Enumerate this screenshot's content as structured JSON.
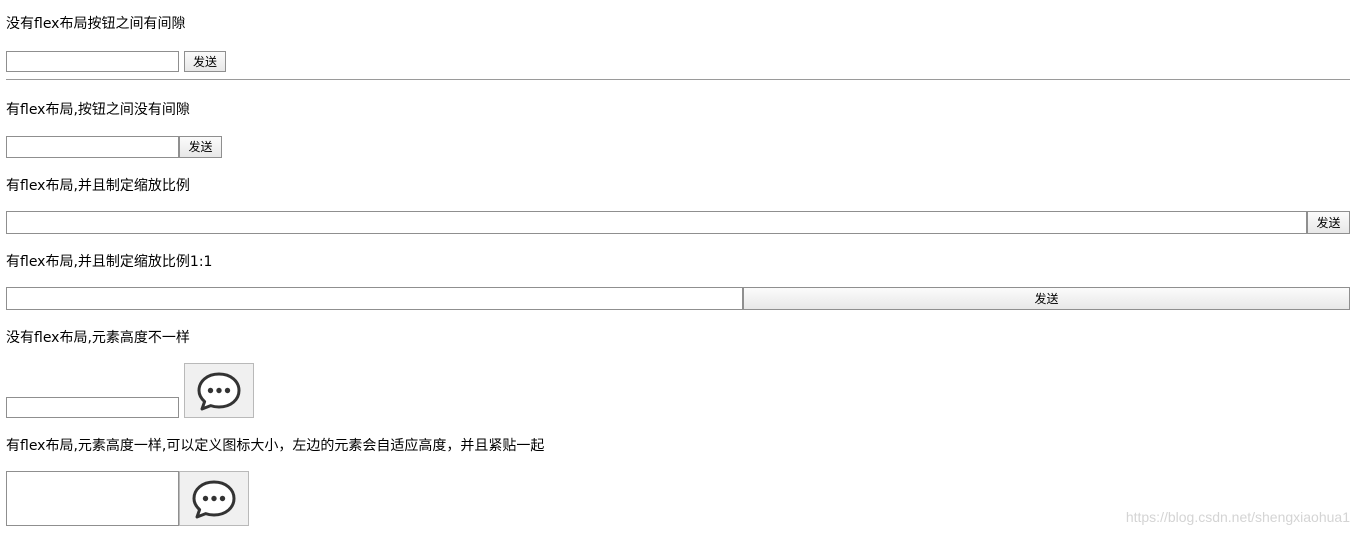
{
  "sections": [
    {
      "caption": "没有flex布局按钮之间有间隙",
      "button": "发送"
    },
    {
      "caption": "有flex布局,按钮之间没有间隙",
      "button": "发送"
    },
    {
      "caption": "有flex布局,并且制定缩放比例",
      "button": "发送"
    },
    {
      "caption": "有flex布局,并且制定缩放比例1:1",
      "button": "发送"
    },
    {
      "caption": "没有flex布局,元素高度不一样",
      "button_icon": "chat-bubble-icon"
    },
    {
      "caption": "有flex布局,元素高度一样,可以定义图标大小，左边的元素会自适应高度，并且紧贴一起",
      "button_icon": "chat-bubble-icon"
    }
  ],
  "inputs": {
    "values": [
      "",
      "",
      "",
      "",
      "",
      ""
    ]
  },
  "watermark": "https://blog.csdn.net/shengxiaohua1",
  "colors": {
    "border": "#8f8f8f",
    "separator": "#9a9a9a",
    "icon": "#333333"
  }
}
